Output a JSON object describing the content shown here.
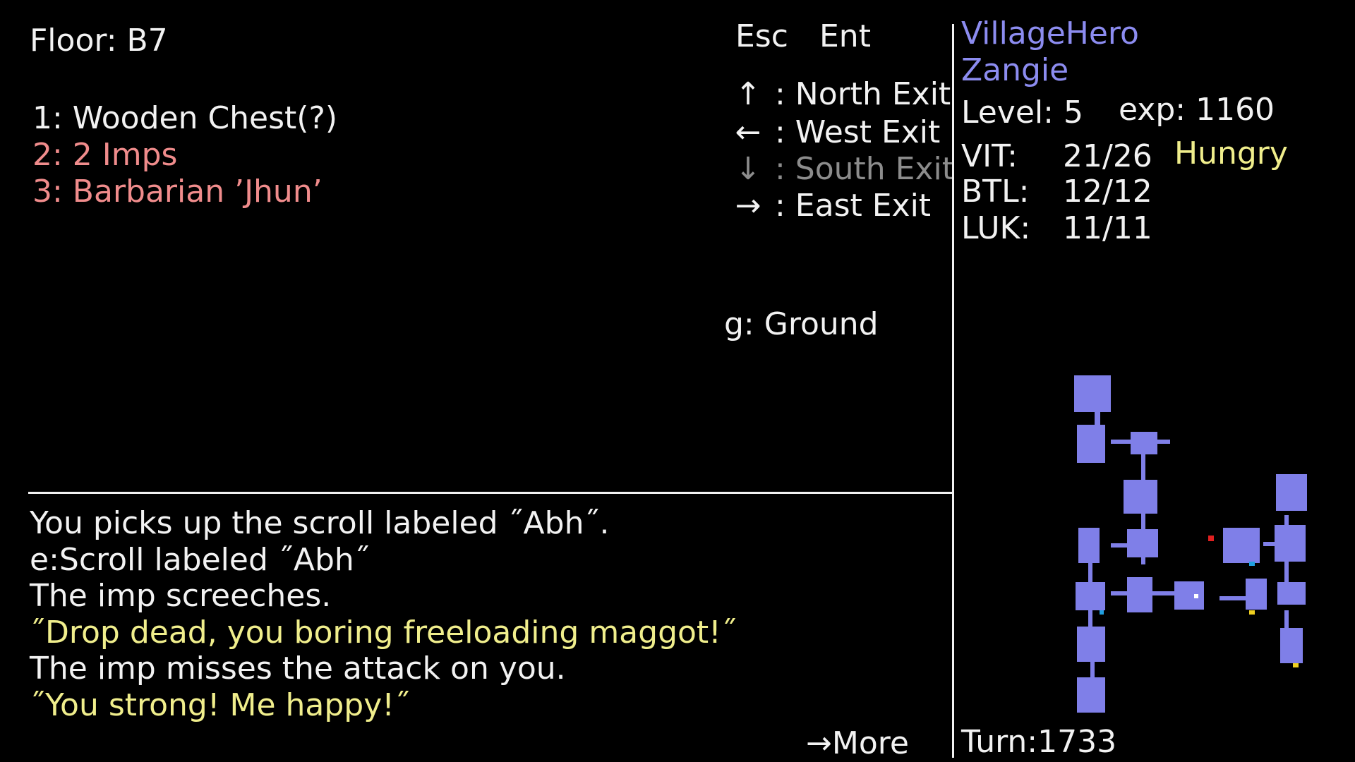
{
  "colors": {
    "background": "#000000",
    "text": "#f2f2f2",
    "enemy": "#f08c8c",
    "speech": "#f0ee8c",
    "party": "#8c8cf0",
    "disabled": "#8c8c8c",
    "map_room": "#7f7fe8"
  },
  "location": {
    "floor_label": "Floor: B7"
  },
  "entities": [
    {
      "label": "1: Wooden Chest(?)",
      "kind": "item"
    },
    {
      "label": "2: 2 Imps",
      "kind": "enemy"
    },
    {
      "label": "3: Barbarian ’Jhun’",
      "kind": "enemy"
    }
  ],
  "controls": {
    "esc_label": "Esc",
    "enter_label": "Ent",
    "exits": [
      {
        "key": "↑",
        "label": ": North Exit",
        "enabled": true
      },
      {
        "key": "←",
        "label": ": West Exit",
        "enabled": true
      },
      {
        "key": "↓",
        "label": ": South Exit",
        "enabled": false
      },
      {
        "key": "→",
        "label": ": East Exit",
        "enabled": true
      }
    ],
    "ground_label": "g: Ground"
  },
  "log": {
    "messages": [
      {
        "text": "You picks up the scroll labeled ˝Abh˝.",
        "style": "normal"
      },
      {
        "text": "e:Scroll labeled ˝Abh˝",
        "style": "normal"
      },
      {
        "text": "The imp screeches.",
        "style": "normal"
      },
      {
        "text": "˝Drop dead, you boring freeloading maggot!˝",
        "style": "speech"
      },
      {
        "text": "The imp misses the attack on you.",
        "style": "normal"
      },
      {
        "text": "˝You strong! Me happy!˝",
        "style": "speech"
      }
    ],
    "more_label": "→More"
  },
  "status": {
    "name": "VillageHero",
    "party": "Zangie",
    "level_label": "Level: 5",
    "exp_label": "exp: 1160",
    "stats": [
      {
        "label": "VIT:",
        "value": "21/26"
      },
      {
        "label": "BTL:",
        "value": "12/12"
      },
      {
        "label": "LUK:",
        "value": "11/11"
      }
    ],
    "condition": "Hungry",
    "turn_label": "Turn:1733"
  }
}
